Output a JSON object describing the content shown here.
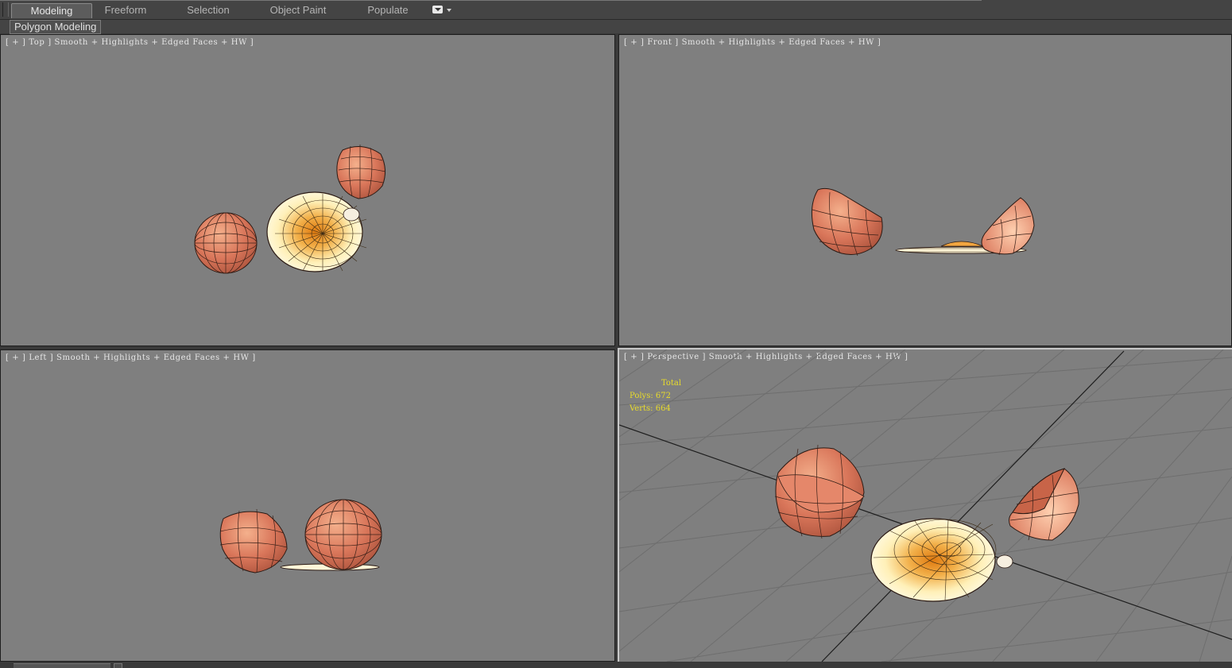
{
  "ribbon": {
    "tabs": [
      {
        "label": "Modeling",
        "active": true
      },
      {
        "label": "Freeform",
        "active": false
      },
      {
        "label": "Selection",
        "active": false
      },
      {
        "label": "Object Paint",
        "active": false
      },
      {
        "label": "Populate",
        "active": false
      }
    ],
    "sub_label": "Polygon Modeling"
  },
  "viewports": {
    "top": {
      "label": "[ + ] Top ] Smooth + Highlights + Edged Faces + HW ]"
    },
    "front": {
      "label": "[ + ] Front ] Smooth + Highlights + Edged Faces + HW ]"
    },
    "left": {
      "label": "[ + ] Left ] Smooth + Highlights + Edged Faces + HW ]"
    },
    "perspective": {
      "label": "[ + ] Perspective ] Smooth + Highlights + Edged Faces + HW ]",
      "stats": {
        "total": "Total",
        "polys": "Polys: 672",
        "verts": "Verts: 664"
      }
    }
  },
  "colors": {
    "viewport_bg": "#7f7f7f",
    "shell": "#d9765a",
    "plate": "#fff3c0",
    "yolk": "#f0a030",
    "stats_text": "#e9dc2a"
  }
}
